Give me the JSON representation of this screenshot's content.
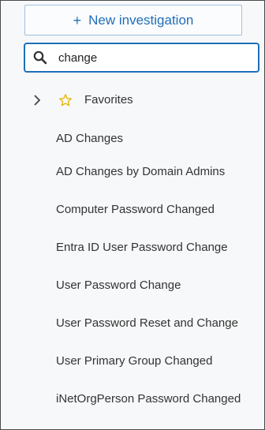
{
  "new_investigation": {
    "label": "New investigation",
    "icon": "plus-icon"
  },
  "search": {
    "value": "change",
    "placeholder": "",
    "icon": "search-icon"
  },
  "favorites": {
    "label": "Favorites",
    "expand_icon": "chevron-right-icon",
    "star_icon": "star-outline-icon"
  },
  "results": [
    "AD Changes",
    "AD Changes by Domain Admins",
    "Computer Password Changed",
    "Entra ID User Password Change",
    "User Password Change",
    "User Password Reset and Change",
    "User Primary Group Changed",
    "iNetOrgPerson Password Changed"
  ],
  "colors": {
    "accent": "#1f6fb8",
    "star": "#e8b400",
    "panel_bg": "#f7f8fa"
  }
}
